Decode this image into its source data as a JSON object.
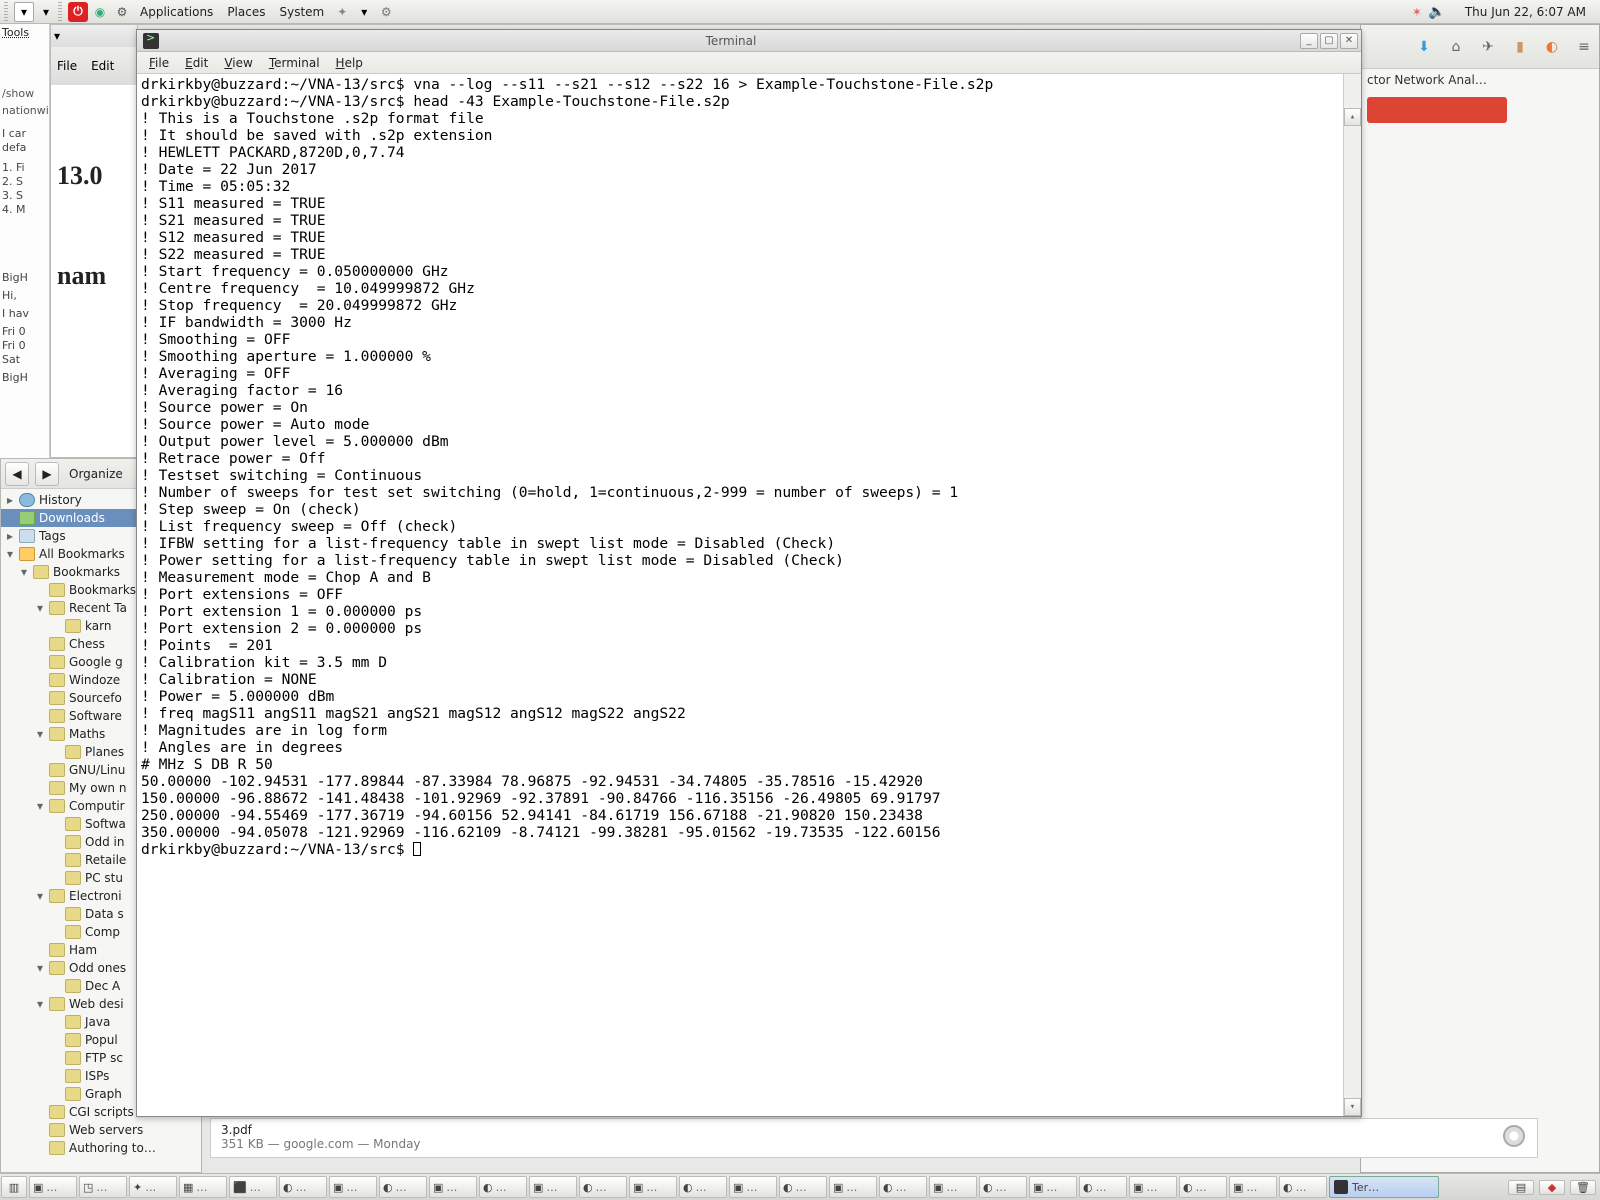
{
  "panel": {
    "menus": [
      "Applications",
      "Places",
      "System"
    ],
    "clock": "Thu Jun 22,  6:07 AM"
  },
  "left_strip": {
    "tools": "Tools",
    "show": "/show",
    "nationwide": "nationwide",
    "frags": [
      "I car",
      "defa",
      "1. Fi",
      "2. S",
      "3. S",
      "4. M"
    ],
    "mail": [
      "BigH",
      "Hi,",
      "I hav",
      "Fri 0",
      "Fri 0",
      "Sat",
      "BigH"
    ]
  },
  "mail": {
    "file": "File",
    "edit": "Edit",
    "big1": "13.0",
    "big2": "nam"
  },
  "library": {
    "organize": "Organize",
    "items": [
      {
        "exp": "▸",
        "icon": "hist",
        "label": "History",
        "sel": false,
        "ind": 0
      },
      {
        "exp": "",
        "icon": "dl",
        "label": "Downloads",
        "sel": true,
        "ind": 0
      },
      {
        "exp": "▸",
        "icon": "tag",
        "label": "Tags",
        "sel": false,
        "ind": 0
      },
      {
        "exp": "▾",
        "icon": "star",
        "label": "All Bookmarks",
        "sel": false,
        "ind": 0
      },
      {
        "exp": "▾",
        "icon": "",
        "label": "Bookmarks",
        "sel": false,
        "ind": 1
      },
      {
        "exp": "",
        "icon": "",
        "label": "Bookmarks",
        "sel": false,
        "ind": 2
      },
      {
        "exp": "▾",
        "icon": "",
        "label": "Recent Ta",
        "sel": false,
        "ind": 2
      },
      {
        "exp": "",
        "icon": "",
        "label": "karn",
        "sel": false,
        "ind": 3
      },
      {
        "exp": "",
        "icon": "",
        "label": "Chess",
        "sel": false,
        "ind": 2
      },
      {
        "exp": "",
        "icon": "",
        "label": "Google g",
        "sel": false,
        "ind": 2
      },
      {
        "exp": "",
        "icon": "",
        "label": "Windoze",
        "sel": false,
        "ind": 2
      },
      {
        "exp": "",
        "icon": "",
        "label": "Sourcefo",
        "sel": false,
        "ind": 2
      },
      {
        "exp": "",
        "icon": "",
        "label": "Software",
        "sel": false,
        "ind": 2
      },
      {
        "exp": "▾",
        "icon": "",
        "label": "Maths",
        "sel": false,
        "ind": 2
      },
      {
        "exp": "",
        "icon": "",
        "label": "Planes",
        "sel": false,
        "ind": 3
      },
      {
        "exp": "",
        "icon": "",
        "label": "GNU/Linu",
        "sel": false,
        "ind": 2
      },
      {
        "exp": "",
        "icon": "",
        "label": "My own n",
        "sel": false,
        "ind": 2
      },
      {
        "exp": "▾",
        "icon": "",
        "label": "Computir",
        "sel": false,
        "ind": 2
      },
      {
        "exp": "",
        "icon": "",
        "label": "Softwa",
        "sel": false,
        "ind": 3
      },
      {
        "exp": "",
        "icon": "",
        "label": "Odd in",
        "sel": false,
        "ind": 3
      },
      {
        "exp": "",
        "icon": "",
        "label": "Retaile",
        "sel": false,
        "ind": 3
      },
      {
        "exp": "",
        "icon": "",
        "label": "PC stu",
        "sel": false,
        "ind": 3
      },
      {
        "exp": "▾",
        "icon": "",
        "label": "Electroni",
        "sel": false,
        "ind": 2
      },
      {
        "exp": "",
        "icon": "",
        "label": "Data s",
        "sel": false,
        "ind": 3
      },
      {
        "exp": "",
        "icon": "",
        "label": "Comp",
        "sel": false,
        "ind": 3
      },
      {
        "exp": "",
        "icon": "",
        "label": "Ham",
        "sel": false,
        "ind": 2
      },
      {
        "exp": "▾",
        "icon": "",
        "label": "Odd ones",
        "sel": false,
        "ind": 2
      },
      {
        "exp": "",
        "icon": "",
        "label": "Dec A",
        "sel": false,
        "ind": 3
      },
      {
        "exp": "▾",
        "icon": "",
        "label": "Web desi",
        "sel": false,
        "ind": 2
      },
      {
        "exp": "",
        "icon": "",
        "label": "Java",
        "sel": false,
        "ind": 3
      },
      {
        "exp": "",
        "icon": "",
        "label": "Popul",
        "sel": false,
        "ind": 3
      },
      {
        "exp": "",
        "icon": "",
        "label": "FTP sc",
        "sel": false,
        "ind": 3
      },
      {
        "exp": "",
        "icon": "",
        "label": "ISPs",
        "sel": false,
        "ind": 3
      },
      {
        "exp": "",
        "icon": "",
        "label": "Graph",
        "sel": false,
        "ind": 3
      },
      {
        "exp": "",
        "icon": "",
        "label": "CGI scripts",
        "sel": false,
        "ind": 2
      },
      {
        "exp": "",
        "icon": "",
        "label": "Web servers",
        "sel": false,
        "ind": 2
      },
      {
        "exp": "",
        "icon": "",
        "label": "Authoring to…",
        "sel": false,
        "ind": 2
      }
    ]
  },
  "bg_browser": {
    "title": "ctor Network Anal…"
  },
  "file_row": {
    "name": "3.pdf",
    "meta": "351 KB — google.com — Monday"
  },
  "terminal": {
    "title": "Terminal",
    "menus": [
      "File",
      "Edit",
      "View",
      "Terminal",
      "Help"
    ],
    "lines": [
      "drkirkby@buzzard:~/VNA-13/src$ vna --log --s11 --s21 --s12 --s22 16 > Example-Touchstone-File.s2p",
      "drkirkby@buzzard:~/VNA-13/src$ head -43 Example-Touchstone-File.s2p",
      "! This is a Touchstone .s2p format file",
      "! It should be saved with .s2p extension",
      "! HEWLETT PACKARD,8720D,0,7.74",
      "! Date = 22 Jun 2017",
      "! Time = 05:05:32",
      "! S11 measured = TRUE",
      "! S21 measured = TRUE",
      "! S12 measured = TRUE",
      "! S22 measured = TRUE",
      "! Start frequency = 0.050000000 GHz",
      "! Centre frequency  = 10.049999872 GHz",
      "! Stop frequency  = 20.049999872 GHz",
      "! IF bandwidth = 3000 Hz",
      "! Smoothing = OFF",
      "! Smoothing aperture = 1.000000 %",
      "! Averaging = OFF",
      "! Averaging factor = 16",
      "! Source power = On",
      "! Source power = Auto mode",
      "! Output power level = 5.000000 dBm",
      "! Retrace power = Off",
      "! Testset switching = Continuous",
      "! Number of sweeps for test set switching (0=hold, 1=continuous,2-999 = number of sweeps) = 1",
      "! Step sweep = On (check)",
      "! List frequency sweep = Off (check)",
      "! IFBW setting for a list-frequency table in swept list mode = Disabled (Check)",
      "! Power setting for a list-frequency table in swept list mode = Disabled (Check)",
      "! Measurement mode = Chop A and B",
      "! Port extensions = OFF",
      "! Port extension 1 = 0.000000 ps",
      "! Port extension 2 = 0.000000 ps",
      "! Points  = 201",
      "! Calibration kit = 3.5 mm D",
      "! Calibration = NONE",
      "! Power = 5.000000 dBm",
      "! freq magS11 angS11 magS21 angS21 magS12 angS12 magS22 angS22",
      "! Magnitudes are in log form",
      "! Angles are in degrees",
      "# MHz S DB R 50",
      "50.00000 -102.94531 -177.89844 -87.33984 78.96875 -92.94531 -34.74805 -35.78516 -15.42920",
      "150.00000 -96.88672 -141.48438 -101.92969 -92.37891 -90.84766 -116.35156 -26.49805 69.91797",
      "250.00000 -94.55469 -177.36719 -94.60156 52.94141 -84.61719 156.67188 -21.90820 150.23438",
      "350.00000 -94.05078 -121.92969 -116.62109 -8.74121 -99.38281 -95.01562 -19.73535 -122.60156"
    ],
    "prompt": "drkirkby@buzzard:~/VNA-13/src$ "
  },
  "taskbar": {
    "count": 26
  }
}
